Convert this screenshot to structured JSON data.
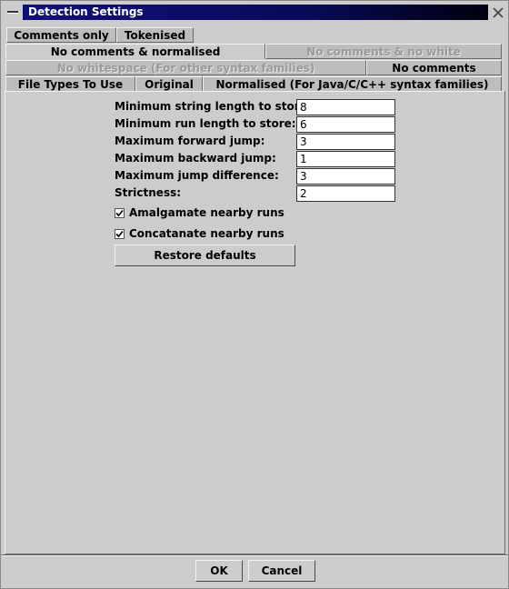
{
  "window": {
    "title": "Detection Settings"
  },
  "tabs": {
    "row1": [
      {
        "label": "Comments only"
      },
      {
        "label": "Tokenised"
      }
    ],
    "row2": [
      {
        "label": "No comments & normalised",
        "selected": true
      },
      {
        "label": "No comments & no white",
        "disabled": true
      }
    ],
    "row3": [
      {
        "label": "No whitespace (For other syntax families)",
        "disabled": true
      },
      {
        "label": "No comments"
      }
    ],
    "row4": [
      {
        "label": "File Types To Use"
      },
      {
        "label": "Original"
      },
      {
        "label": "Normalised (For Java/C/C++ syntax families)"
      }
    ]
  },
  "settings": {
    "min_string_length": {
      "label": "Minimum string length to store:",
      "value": "8"
    },
    "min_run_length": {
      "label": "Minimum run length to store:",
      "value": "6"
    },
    "max_forward_jump": {
      "label": "Maximum forward jump:",
      "value": "3"
    },
    "max_backward_jump": {
      "label": "Maximum backward jump:",
      "value": "1"
    },
    "max_jump_difference": {
      "label": "Maximum jump difference:",
      "value": "3"
    },
    "strictness": {
      "label": "Strictness:",
      "value": "2"
    }
  },
  "checkboxes": {
    "amalgamate": {
      "label": "Amalgamate nearby runs",
      "checked": true
    },
    "concatanate": {
      "label": "Concatanate nearby runs",
      "checked": true
    }
  },
  "buttons": {
    "restore_defaults": "Restore defaults",
    "ok": "OK",
    "cancel": "Cancel"
  },
  "colors": {
    "background": "#cccccc",
    "title_bar": "#10107a",
    "disabled_text": "#9a9a9a"
  }
}
